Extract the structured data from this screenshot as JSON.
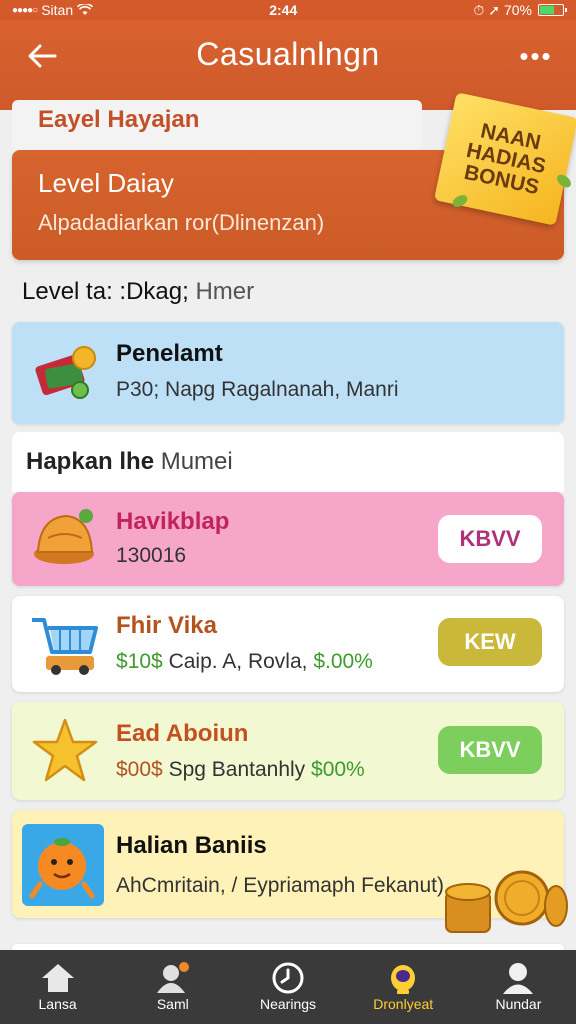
{
  "status_bar": {
    "carrier": "Sitan",
    "time": "2:44",
    "battery": "70%",
    "battery_level": 0.7
  },
  "header": {
    "title": "Casualnlngn",
    "more_label": "•••"
  },
  "top_card": {
    "label": "Eayel Hayajan"
  },
  "level_card": {
    "title": "Level Daiay",
    "subtitle": "Alpadadiarkan ror(Dlinenzan)"
  },
  "bonus_badge": {
    "line1": "NAAN",
    "line2": "HADIAS",
    "line3": "BONUS"
  },
  "section1": {
    "label_main": "Level",
    "label_rest": "ta: :Dkag;",
    "label_muted": "Hmer"
  },
  "section2": {
    "label_main": "Hapkan lhe",
    "label_muted": "Mumei"
  },
  "items": [
    {
      "title": "Penelamt",
      "subtitle": "P30; Napg Ragalnanah, Manri",
      "icon": "wallet-coin-icon",
      "title_color": "#111111"
    },
    {
      "title": "Havikblap",
      "subtitle": "130016",
      "icon": "bell-icon",
      "button": "KBVV",
      "title_color": "#c0245a"
    },
    {
      "title": "Fhir Vika",
      "subtitle_prefix": "$10$",
      "subtitle_mid": "Caip. A, Rovla,",
      "subtitle_suffix": "$.00%",
      "icon": "shopping-cart-icon",
      "button": "KEW",
      "title_color": "#b5531f"
    },
    {
      "title": "Ead Aboiun",
      "subtitle_prefix": "$00$",
      "subtitle_mid": "Spg Bantanhly",
      "subtitle_suffix": "$00%",
      "icon": "star-icon",
      "button": "KBVV",
      "title_color": "#c4501f"
    },
    {
      "title": "Halian Baniis",
      "subtitle": "AhCmritain, / Eypriamaph Fekanut)",
      "icon": "orange-character-icon",
      "title_color": "#111111"
    }
  ],
  "bottom_nav": [
    {
      "label": "Lansa",
      "icon": "home-icon"
    },
    {
      "label": "Saml",
      "icon": "user-notification-icon"
    },
    {
      "label": "Nearings",
      "icon": "clock-icon"
    },
    {
      "label": "Dronlyeat",
      "icon": "trophy-icon"
    },
    {
      "label": "Nundar",
      "icon": "profile-icon"
    }
  ],
  "colors": {
    "brand": "#d45a2b",
    "nav_active": "#ffcf33",
    "green_value": "#3f9a2f"
  }
}
